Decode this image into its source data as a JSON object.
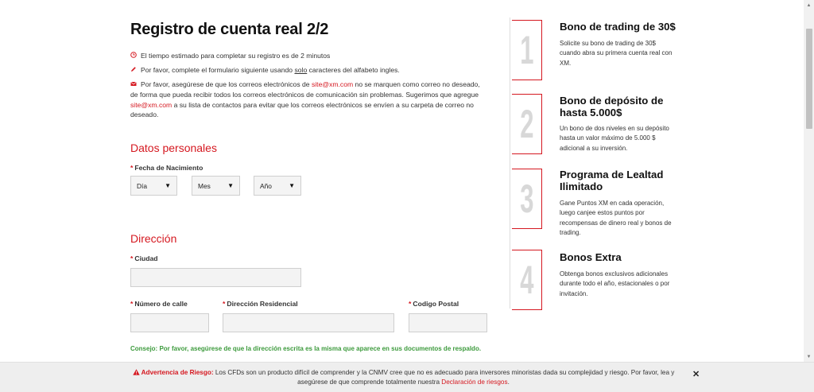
{
  "title": "Registro de cuenta real 2/2",
  "notices": {
    "time": "El tiempo estimado para completar su registro es de 2 minutos",
    "alphabet_pre": "Por favor, complete el formulario siguiente usando ",
    "alphabet_u": "solo",
    "alphabet_post": " caracteres del alfabeto ingles.",
    "email_p1": "Por favor, asegúrese de que los correos electrónicos de ",
    "email_link1": "site@xm.com",
    "email_p2": " no se marquen como correo no deseado, de forma que pueda recibir todos los correos electrónicos de comunicación sin problemas. Sugerimos que agregue ",
    "email_link2": "site@xm.com",
    "email_p3": " a su lista de contactos para evitar que los correos electrónicos se envíen a su carpeta de correo no deseado."
  },
  "personal": {
    "heading": "Datos personales",
    "dob_label": "Fecha de Nacimiento",
    "day": "Día",
    "month": "Mes",
    "year": "Año"
  },
  "address": {
    "heading": "Dirección",
    "city_label": "Ciudad",
    "street_no_label": "Número de calle",
    "street_label": "Dirección Residencial",
    "postal_label": "Codigo Postal",
    "city_value": "",
    "street_no_value": "",
    "street_value": "",
    "postal_value": "",
    "hint": "Consejo: Por favor, asegúrese de que la dirección escrita es la misma que aparece en sus documentos de respaldo."
  },
  "required_mark": "*",
  "bonuses": [
    {
      "number": "1",
      "title": "Bono de trading de 30$",
      "text": "Solicite su bono de trading de 30$ cuando abra su primera cuenta real con XM."
    },
    {
      "number": "2",
      "title": "Bono de depósito de hasta 5.000$",
      "text": "Un bono de dos niveles en su depósito hasta un valor máximo de 5.000 $ adicional a su inversión."
    },
    {
      "number": "3",
      "title": "Programa de Lealtad Ilimitado",
      "text": "Gane Puntos XM en cada operación, luego canjee estos puntos por recompensas de dinero real y bonos de trading."
    },
    {
      "number": "4",
      "title": "Bonos Extra",
      "text": "Obtenga bonos exclusivos adicionales durante todo el año, estacionales o por invitación."
    }
  ],
  "risk": {
    "label": "Advertencia de Riesgo:",
    "text": " Los CFDs son un producto difícil de comprender y la CNMV cree que no es adecuado para inversores minoristas dada su complejidad y riesgo. Por favor, lea y asegúrese de que comprende totalmente nuestra ",
    "link": "Declaración de riesgos",
    "end": ".",
    "close": "✕"
  },
  "colors": {
    "accent": "#d51820",
    "hint": "#3c9a3c",
    "number_gray": "#d8d8d8"
  },
  "icons": {
    "time": "clock-icon",
    "alphabet": "pencil-icon",
    "email": "envelope-icon",
    "warning": "warning-icon",
    "close": "close-icon"
  }
}
